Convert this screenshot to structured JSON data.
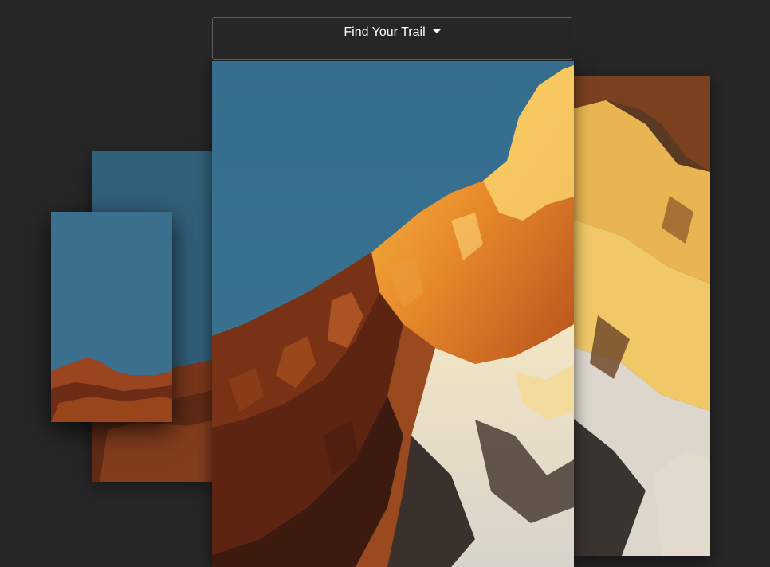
{
  "menu": {
    "toggle_label": "Find Your Trail",
    "toggle_icon": "caret-down-icon"
  },
  "colors": {
    "page_background": "#272727",
    "bar_background": "#262626",
    "bar_border": "#5e5e5e",
    "sky": "#3a6f8e",
    "rock_shadow": "#6b2e17",
    "rock_lit": "#c2601f",
    "glow": "#f2a93a",
    "snow": "#efe3c8"
  }
}
